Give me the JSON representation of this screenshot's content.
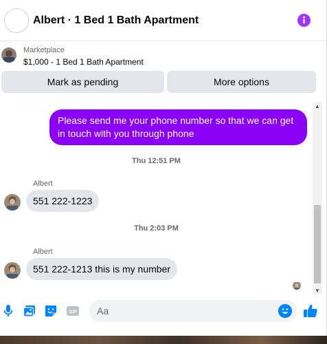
{
  "header": {
    "title": "Albert · 1 Bed 1 Bath Apartment",
    "info_icon": "info-icon"
  },
  "marketplace": {
    "label": "Marketplace",
    "listing": "$1,000 - 1 Bed 1 Bath Apartment",
    "buttons": {
      "pending_label": "Mark as pending",
      "more_label": "More options"
    }
  },
  "messages": [
    {
      "direction": "outgoing",
      "text": "Please send me your phone  number so that we can get in touch with you through phone"
    },
    {
      "type": "timestamp",
      "text": "Thu 12:51 PM"
    },
    {
      "direction": "incoming",
      "sender": "Albert",
      "text": "551 222-1223"
    },
    {
      "type": "timestamp",
      "text": "Thu 2:03 PM"
    },
    {
      "direction": "incoming",
      "sender": "Albert",
      "text": "551 222-1213 this is my number"
    }
  ],
  "composer": {
    "placeholder": "Aa",
    "icons": [
      "mic-icon",
      "image-icon",
      "sticker-icon",
      "gif-icon",
      "emoji-icon",
      "thumbs-up-icon"
    ],
    "gif_label": "GIF"
  },
  "colors": {
    "accent": "#8a01f5",
    "messenger_blue": "#0084ff",
    "bubble_gray": "#e4e6eb"
  }
}
